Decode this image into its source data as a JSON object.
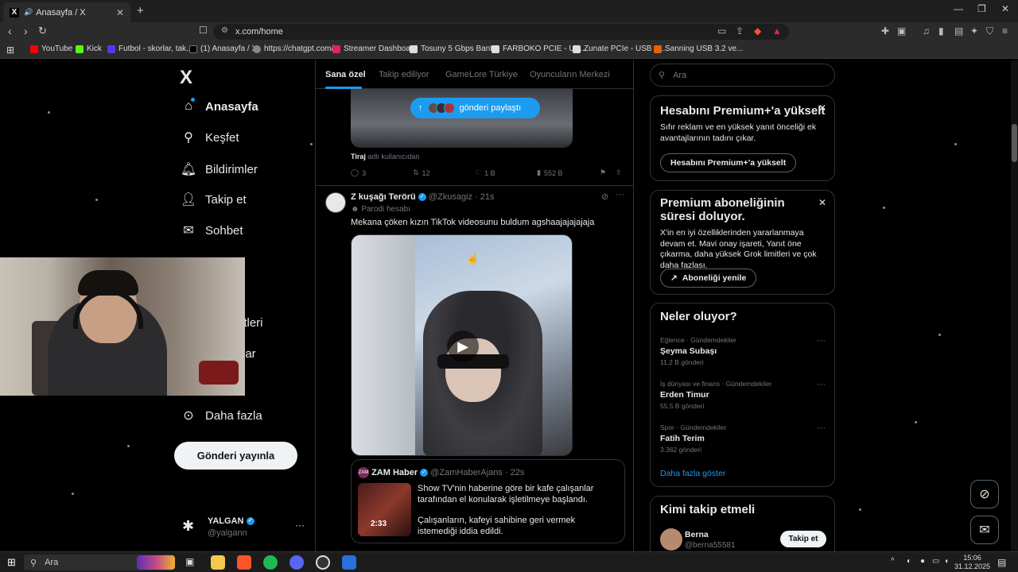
{
  "browser": {
    "tab_title": "Anasayfa / X",
    "url": "x.com/home",
    "bookmarks": [
      {
        "label": "YouTube",
        "color": "#ff0000"
      },
      {
        "label": "Kick",
        "color": "#53fc18"
      },
      {
        "label": "Futbol - skorlar, tak...",
        "color": "#4b3cf0"
      },
      {
        "label": "(1) Anasayfa / X",
        "color": "#000000"
      },
      {
        "label": "https://chatgpt.com/",
        "color": "#888888"
      },
      {
        "label": "Streamer Dashboard",
        "color": "#e0245e"
      },
      {
        "label": "Tosuny 5 Gbps Bant...",
        "color": "#dddddd"
      },
      {
        "label": "FARBOKO PCIE - US...",
        "color": "#dddddd"
      },
      {
        "label": "Zunate PCIe - USB 3....",
        "color": "#dddddd"
      },
      {
        "label": "Sanning USB 3.2 ve...",
        "color": "#e36209"
      }
    ]
  },
  "sidebar": {
    "logo": "X",
    "items": [
      {
        "label": "Anasayfa",
        "icon": "home-icon"
      },
      {
        "label": "Keşfet",
        "icon": "search-icon"
      },
      {
        "label": "Bildirimler",
        "icon": "bell-icon"
      },
      {
        "label": "Takip et",
        "icon": "person-add-icon"
      },
      {
        "label": "Sohbet",
        "icon": "mail-icon"
      },
      {
        "label": "etleri",
        "icon": ""
      },
      {
        "label": "lar",
        "icon": ""
      },
      {
        "label": "Daha fazla",
        "icon": "more-circle-icon"
      }
    ],
    "post_button": "Gönderi yayınla",
    "profile": {
      "name": "YALGAN",
      "handle": "@yalgann"
    }
  },
  "feed": {
    "tabs": [
      "Sana özel",
      "Takip ediliyor",
      "GameLore Türkiye",
      "Oyuncuların Merkezi"
    ],
    "share_pill": "gönderi paylaştı",
    "prev_post": {
      "caption_bold": "Tiraj",
      "caption_rest": "adlı kullanıcıdan",
      "replies": "3",
      "reposts": "12",
      "likes": "1 B",
      "views": "552 B"
    },
    "post": {
      "name": "Z kuşağı Terörü",
      "handle": "@Zkusagiz",
      "time": "· 21s",
      "parody": "Parodi hesabı",
      "text": "Mekana çöken kızın TikTok videosunu buldum agshaajajajajaja",
      "quote": {
        "name": "ZAM Haber",
        "handle": "@ZamHaberAjans",
        "time": "· 22s",
        "logo": "ZAM",
        "duration": "2:33",
        "text1": "Show TV'nin haberine göre bir kafe çalışanlar tarafından el konularak işletilmeye başlandı.",
        "text2": "Çalışanların, kafeyi sahibine geri vermek istemediği iddia edildi."
      }
    }
  },
  "right": {
    "search_placeholder": "Ara",
    "premium_card": {
      "title": "Hesabını Premium+'a yükselt",
      "body": "Sıfır reklam ve en yüksek yanıt önceliği ek avantajlarının tadını çıkar.",
      "button": "Hesabını Premium+'a yükselt"
    },
    "expiry_card": {
      "title": "Premium aboneliğinin süresi doluyor.",
      "body": "X'in en iyi özelliklerinden yararlanmaya devam et. Mavi onay işareti, Yanıt öne çıkarma, daha yüksek Grok limitleri ve çok daha fazlası.",
      "button": "Aboneliği yenile"
    },
    "trends": {
      "title": "Neler oluyor?",
      "items": [
        {
          "category": "Eğlence · Gündemdekiler",
          "title": "Şeyma Subaşı",
          "count": "11,2 B gönderi"
        },
        {
          "category": "İş dünyası ve finans · Gündemdekiler",
          "title": "Erden Timur",
          "count": "55,5 B gönderi"
        },
        {
          "category": "Spor · Gündemdekiler",
          "title": "Fatih Terim",
          "count": "3.362 gönderi"
        }
      ],
      "show_more": "Daha fazla göster"
    },
    "who_to_follow": {
      "title": "Kimi takip etmeli",
      "name": "Berna",
      "handle": "@berna55581",
      "button": "Takip et"
    }
  },
  "taskbar": {
    "search": "Ara",
    "time": "15:06",
    "date": "31.12.2025"
  }
}
